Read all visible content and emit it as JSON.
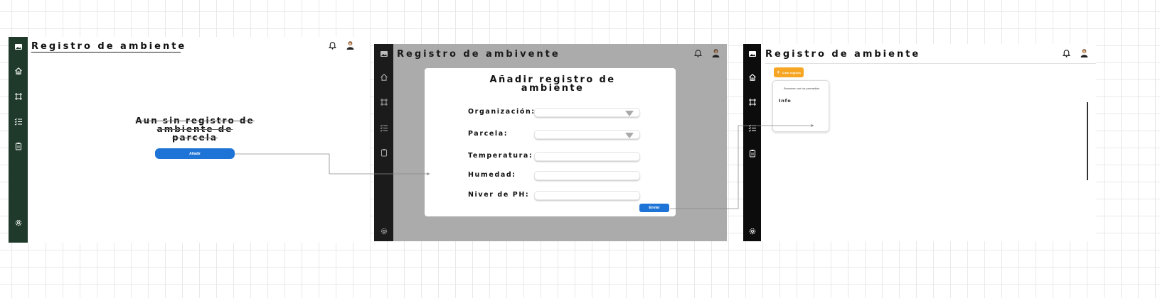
{
  "colors": {
    "frame1_sidebar": "#1f3a2b",
    "frame2_sidebar": "#1b1b1b",
    "frame3_sidebar": "#0c0c0c",
    "modal_overlay": "#ababab",
    "primary_button": "#1e73d6",
    "create_button": "#f6a623"
  },
  "sidebar": {
    "icons": [
      "image-icon",
      "home-icon",
      "frame-icon",
      "checklist-icon",
      "clipboard-icon",
      "gear-icon"
    ]
  },
  "frame1": {
    "title": "Registro de ambiente",
    "empty_message": "Aun sin registro de ambiente de parcela",
    "add_button": "Añadir"
  },
  "frame2": {
    "title": "Registro de ambivente",
    "modal": {
      "title": "Añadir registro de ambiente",
      "fields": [
        {
          "label": "Organización:",
          "value": "",
          "type": "select"
        },
        {
          "label": "Parcela:",
          "value": "",
          "type": "select"
        },
        {
          "label": "Temperatura:",
          "value": "",
          "type": "text"
        },
        {
          "label": "Humedad:",
          "value": "",
          "type": "text"
        },
        {
          "label": "Niver de PH:",
          "value": "",
          "type": "text"
        }
      ],
      "submit_button": "Enviar"
    }
  },
  "frame3": {
    "title": "Registro de ambiente",
    "create_button": "Crear registro",
    "card": {
      "caption": "Sensores con los promedios",
      "info": "Info"
    }
  }
}
